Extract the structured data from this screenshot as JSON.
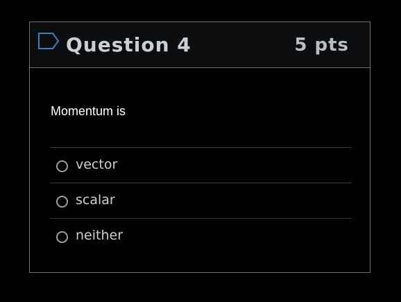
{
  "question": {
    "flag_icon": "flag-outline-icon",
    "title": "Question 4",
    "points": "5 pts",
    "text": "Momentum is",
    "answers": [
      {
        "label": "vector",
        "selected": false
      },
      {
        "label": "scalar",
        "selected": false
      },
      {
        "label": "neither",
        "selected": false
      }
    ]
  },
  "colors": {
    "header_bg": "#0c0d0f",
    "border": "#6e6e6e",
    "title_text": "#c8d0d6",
    "flag_stroke": "#3f7fb5"
  }
}
